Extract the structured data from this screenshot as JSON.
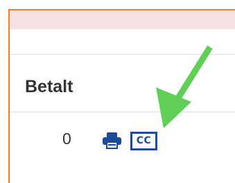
{
  "table": {
    "column_header": "Betalt",
    "row": {
      "value": "0",
      "actions": [
        {
          "icon": "print-icon"
        },
        {
          "icon": "cc-icon",
          "label": "CC"
        }
      ]
    }
  },
  "colors": {
    "frame_border": "#f07e2e",
    "header_band": "#f6e2e4",
    "icon_blue": "#1b4c9a",
    "arrow_green": "#5fcf55"
  }
}
